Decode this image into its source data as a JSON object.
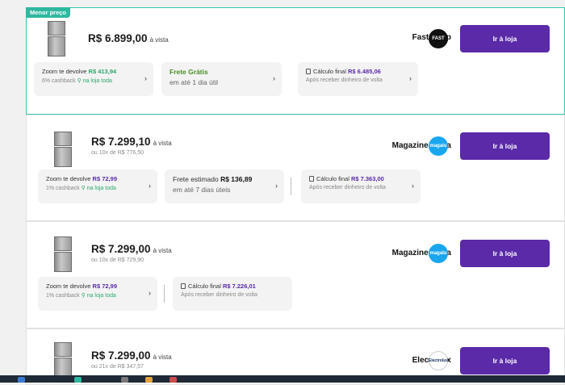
{
  "best_badge": "Menor preço",
  "offers": [
    {
      "price": "R$ 6.899,00",
      "payment": "à vista",
      "installment": "",
      "store": "Fast Shop",
      "logo": "FAST",
      "button": "Ir à loja",
      "zoom_label": "Zoom te devolve",
      "zoom_value": "R$ 413,94",
      "cashback": "6% cashback",
      "cashback_scope": "na loja toda",
      "shipping_title": "Frete Grátis",
      "shipping_sub": "em até 1 dia útil",
      "final_label": "Cálculo final",
      "final_value": "R$ 6.485,06",
      "final_sub": "Após receber dinheiro de volta"
    },
    {
      "price": "R$ 7.299,10",
      "payment": "à vista",
      "installment": "ou 10x de R$ 776,50",
      "store": "Magazine Luiza",
      "logo": "magalu",
      "button": "Ir à loja",
      "zoom_label": "Zoom te devolve",
      "zoom_value": "R$ 72,99",
      "cashback": "1% cashback",
      "cashback_scope": "na loja toda",
      "shipping_title": "Frete estimado",
      "shipping_value": "R$ 136,89",
      "shipping_sub": "em até 7 dias úteis",
      "final_label": "Cálculo final",
      "final_value": "R$ 7.363,00",
      "final_sub": "Após receber dinheiro de volta"
    },
    {
      "price": "R$ 7.299,00",
      "payment": "à vista",
      "installment": "ou 10x de R$ 729,90",
      "store": "Magazine Luiza",
      "logo": "magalu",
      "button": "Ir à loja",
      "zoom_label": "Zoom te devolve",
      "zoom_value": "R$ 72,99",
      "cashback": "1% cashback",
      "cashback_scope": "na loja toda",
      "final_label": "Cálculo final",
      "final_value": "R$ 7.226,01",
      "final_sub": "Após receber dinheiro de volta"
    },
    {
      "price": "R$ 7.299,00",
      "payment": "à vista",
      "installment": "ou 21x de R$ 347,57",
      "store": "Electrolux",
      "logo": "Electrolux",
      "button": "Ir à loja"
    }
  ],
  "colors": {
    "accent": "#5a2aa8",
    "best_border": "#37c6b0",
    "cashback_green": "#2aa86b"
  }
}
